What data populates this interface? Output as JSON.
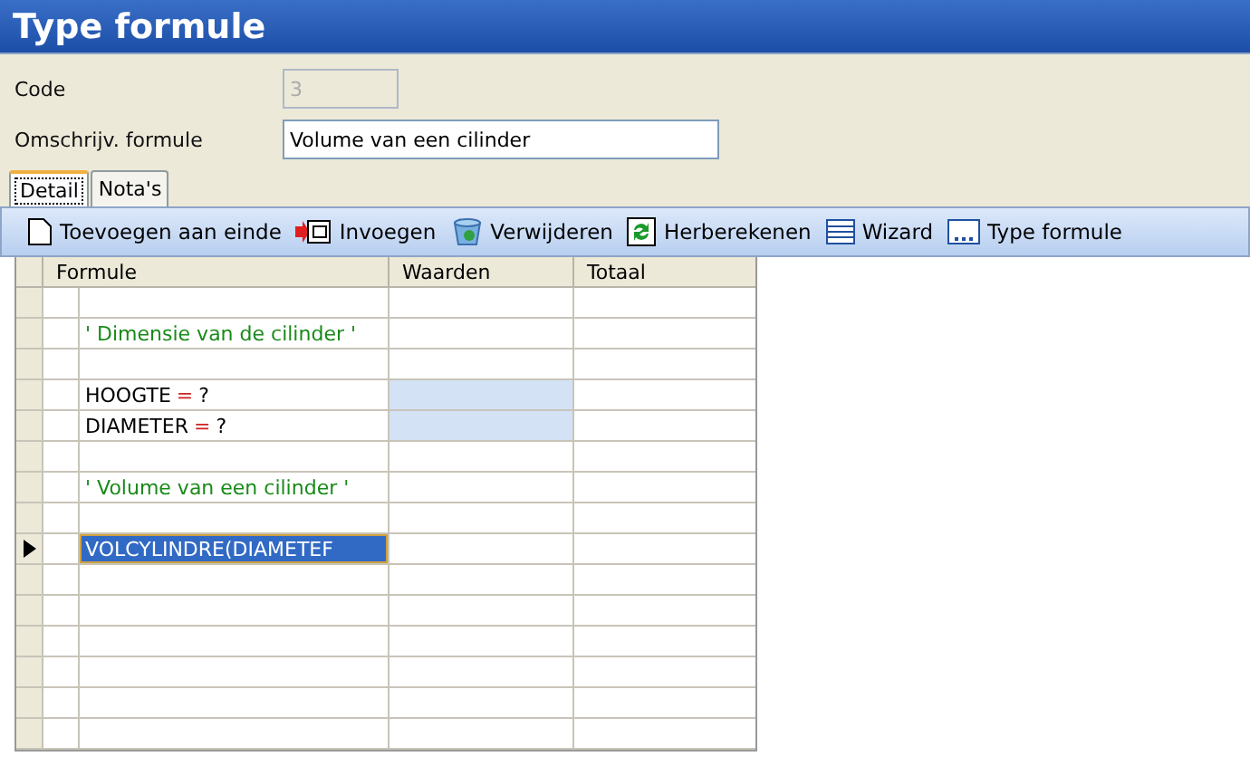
{
  "window": {
    "title": "Type formule"
  },
  "form": {
    "code": {
      "label": "Code",
      "value": "3",
      "disabled": true
    },
    "description": {
      "label": "Omschrijv. formule",
      "value": "Volume van een cilinder"
    }
  },
  "tabs": [
    {
      "label": "Detail",
      "selected": true
    },
    {
      "label": "Nota's",
      "selected": false
    }
  ],
  "toolbar": [
    {
      "label": "Toevoegen aan einde"
    },
    {
      "label": "Invoegen"
    },
    {
      "label": "Verwijderen"
    },
    {
      "label": "Herberekenen"
    },
    {
      "label": "Wizard"
    },
    {
      "label": "Type formule"
    }
  ],
  "table": {
    "columns": [
      "Formule",
      "Waarden",
      "Totaal"
    ],
    "rows": [
      {
        "kind": "empty",
        "selected": false
      },
      {
        "kind": "comment",
        "text": "' Dimensie van de cilinder '",
        "selected": false
      },
      {
        "kind": "empty",
        "selected": false
      },
      {
        "kind": "assignment",
        "variable": "HOOGTE",
        "operator": "=",
        "value": "?",
        "input": true,
        "selected": false
      },
      {
        "kind": "assignment",
        "variable": "DIAMETER",
        "operator": "=",
        "value": "?",
        "input": true,
        "selected": false
      },
      {
        "kind": "empty",
        "selected": false
      },
      {
        "kind": "comment",
        "text": "' Volume van een cilinder '",
        "selected": false
      },
      {
        "kind": "empty",
        "selected": false
      },
      {
        "kind": "expression",
        "text": "VOLCYLINDRE(DIAMETEF",
        "selected": true
      },
      {
        "kind": "empty",
        "selected": false
      },
      {
        "kind": "empty",
        "selected": false
      },
      {
        "kind": "empty",
        "selected": false
      },
      {
        "kind": "empty",
        "selected": false
      },
      {
        "kind": "empty",
        "selected": false
      },
      {
        "kind": "empty",
        "selected": false
      }
    ]
  }
}
